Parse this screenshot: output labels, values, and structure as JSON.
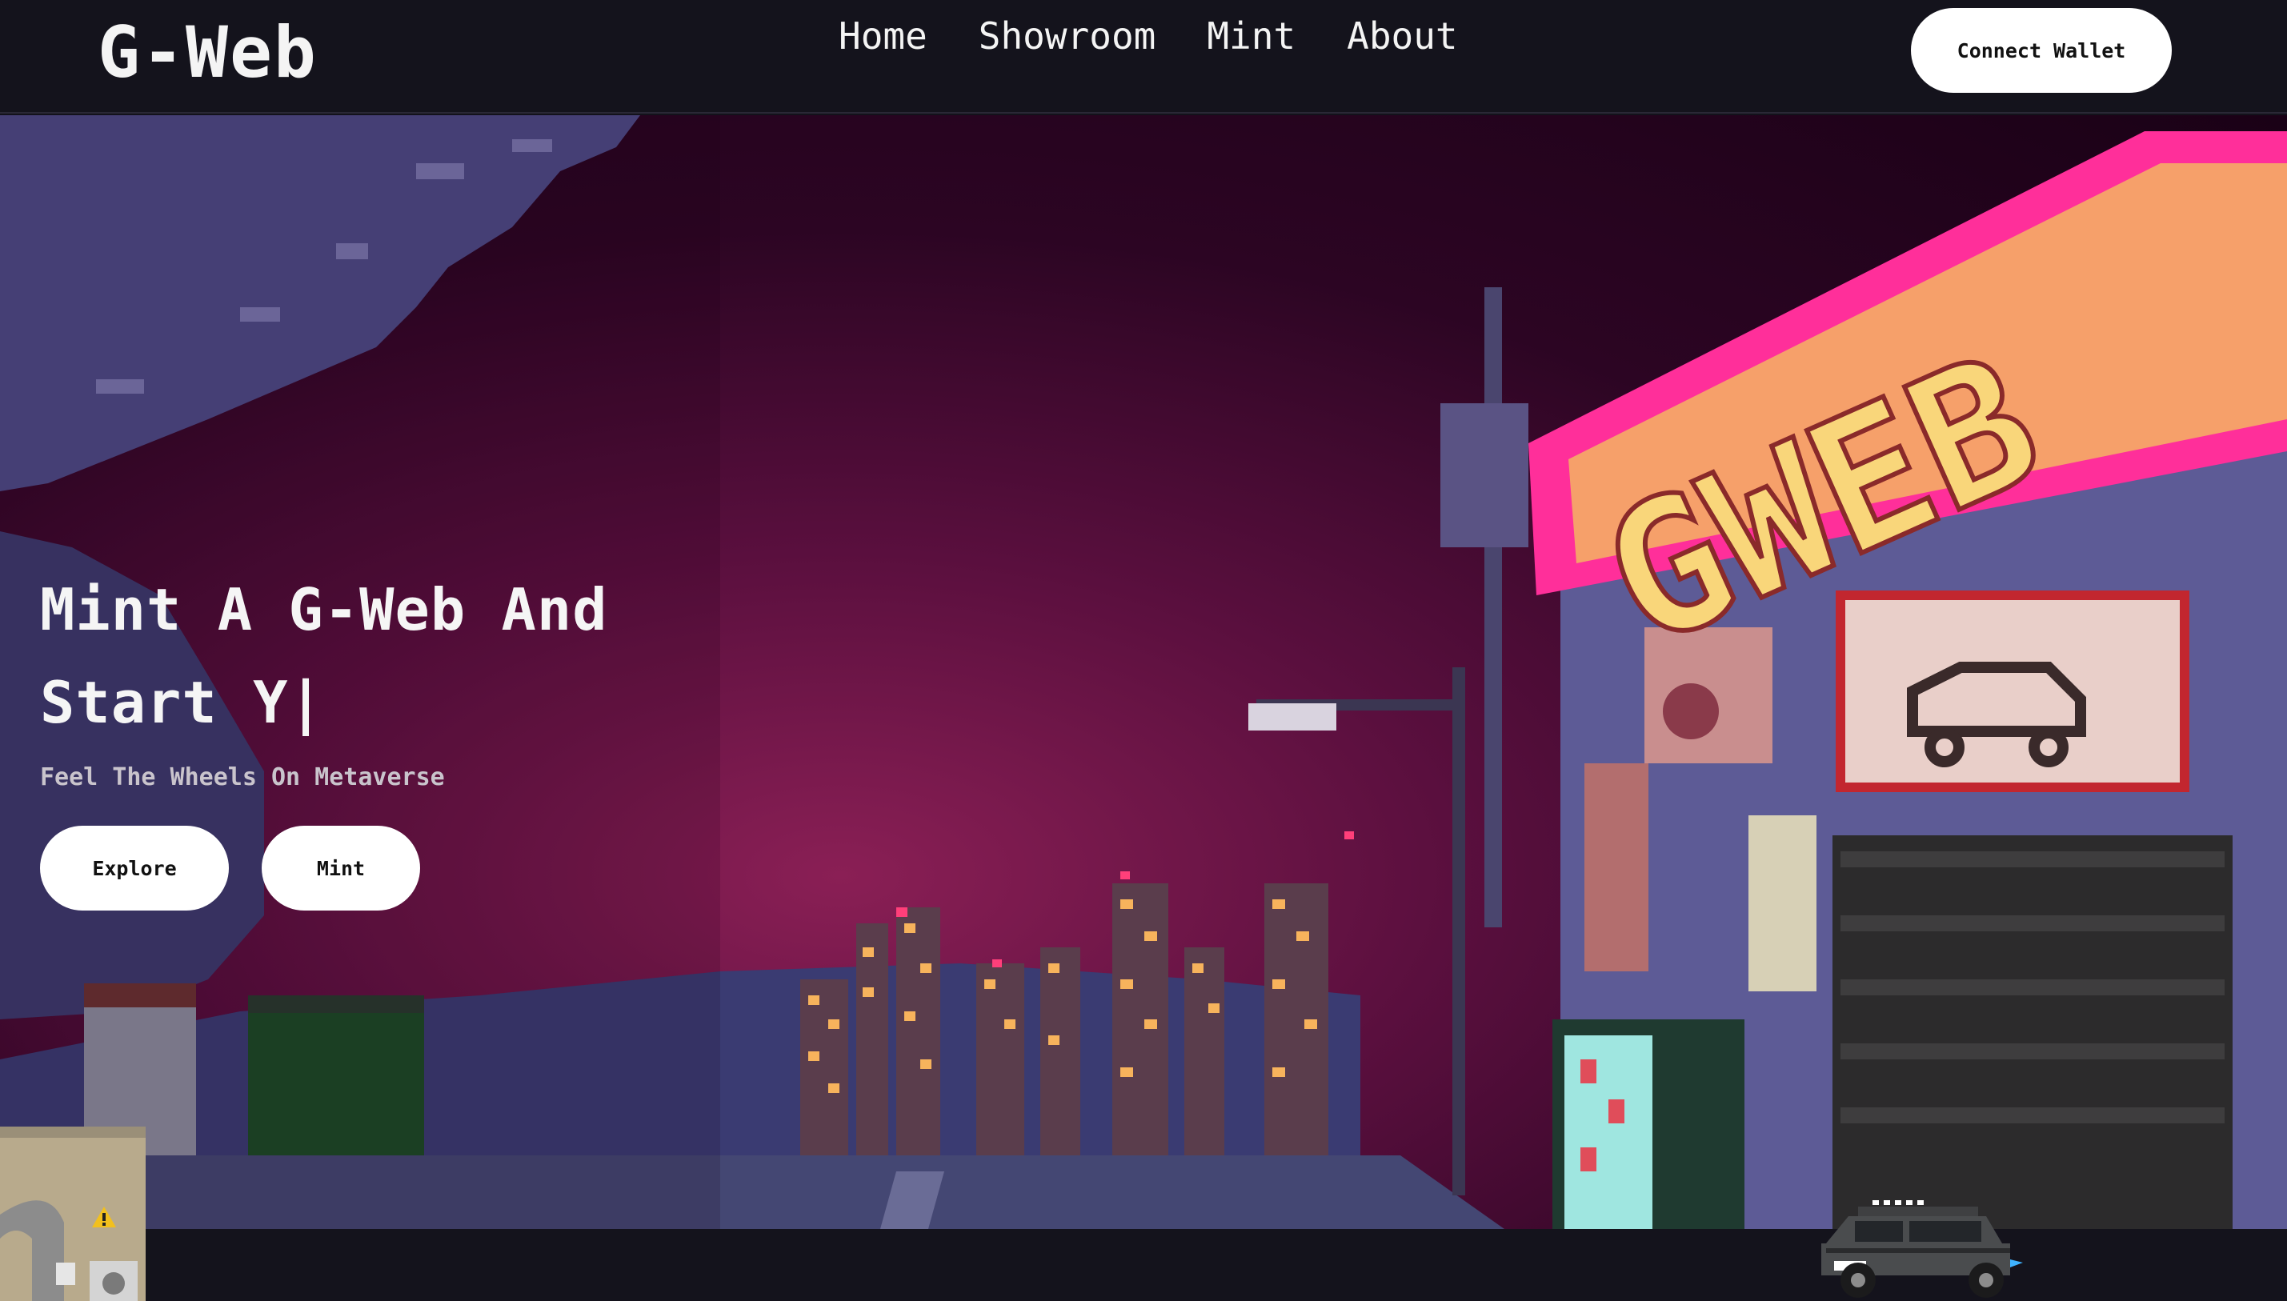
{
  "brand": {
    "logo": "G-Web"
  },
  "nav": {
    "items": [
      {
        "label": "Home"
      },
      {
        "label": "Showroom"
      },
      {
        "label": "Mint"
      },
      {
        "label": "About"
      }
    ],
    "connect_label": "Connect Wallet"
  },
  "hero": {
    "title_line1": "Mint A G-Web And",
    "title_line2": "Start Y|",
    "subtitle": "Feel The Wheels On Metaverse",
    "explore_label": "Explore",
    "mint_label": "Mint",
    "sign_text": "GWEB"
  },
  "colors": {
    "background": "#14131c",
    "neon_pink": "#ff2f9a",
    "sign_fill": "#f6a06a",
    "button_bg": "#ffffff"
  },
  "icons": [
    "warning-icon",
    "car-icon"
  ]
}
